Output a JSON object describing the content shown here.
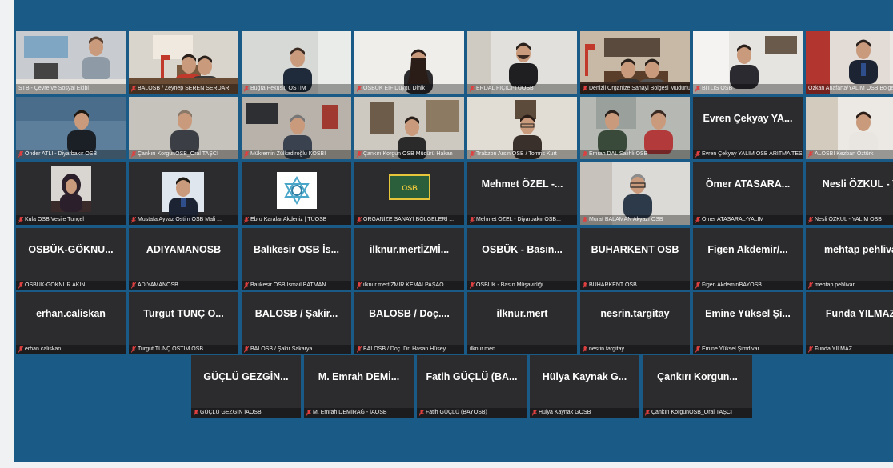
{
  "meeting": {
    "rows": [
      [
        {
          "name": "STB - Çevre ve Sosyal Ekibi",
          "video": "office-map",
          "active": true,
          "muted": false
        },
        {
          "name": "BALOSB / Zeynep SEREN SERDAR",
          "video": "office-flags",
          "muted": true
        },
        {
          "name": "Buğra Pekuslu OSTİM",
          "video": "man-window",
          "muted": true
        },
        {
          "name": "OSBÜK EİF Duygu Dinik",
          "video": "woman-white",
          "muted": true
        },
        {
          "name": "ERDAL FIÇICI-TÜOSB",
          "video": "man-beard",
          "muted": true
        },
        {
          "name": "Denizli Organize Sanayi Bölgesi Müdürlüğü",
          "video": "meeting-room",
          "muted": true
        },
        {
          "name": "BİTLİS OSB",
          "video": "man-office",
          "muted": true
        },
        {
          "name": "Özkan Anafarta/YALIM OSB Bölge Müdürü",
          "video": "man-suit",
          "active": true,
          "muted": false
        }
      ],
      [
        {
          "name": "Önder ATLI - Diyarbakır OSB",
          "video": "man-blue",
          "muted": true
        },
        {
          "name": "Çankırı KorgunOSB_Oral TAŞCI",
          "video": "man-bald",
          "muted": true
        },
        {
          "name": "Mükremin Zülkadiroğlu KOSBİ",
          "video": "man-desk",
          "muted": true
        },
        {
          "name": "Çankırı Korgun OSB Müdürü Hakan",
          "video": "man-laptop",
          "muted": true
        },
        {
          "name": "Trabzon Arsin OSB / Tomris Kurt",
          "video": "woman-glasses",
          "muted": true
        },
        {
          "name": "Emrah DAL Salihli OSB",
          "video": "two-men",
          "muted": true
        },
        {
          "name": "Evren Çekyay YALIM OSB ARITMA TESİSİ MÜ...",
          "display": "Evren Çekyay YA...",
          "muted": true
        },
        {
          "name": "ALOSBİ Kezban Öztürk",
          "video": "woman-smile",
          "muted": true
        }
      ],
      [
        {
          "name": "Kula OSB Vesile Tunçel",
          "video": "woman-hijab",
          "muted": true
        },
        {
          "name": "Mustafa Ayvaz Ostim OSB Mali ...",
          "video": "portrait",
          "muted": true
        },
        {
          "name": "Ebru Karalar Akdeniz | TÜOSB",
          "video": "logo-star",
          "muted": true
        },
        {
          "name": "ORGANİZE SANAYİ BÖLGELERİ ...",
          "video": "logo-osb",
          "muted": true
        },
        {
          "name": "Mehmet ÖZEL - Diyarbakır OSB...",
          "display": "Mehmet ÖZEL -...",
          "muted": true
        },
        {
          "name": "Murat BALAMAN Akyazı OSB",
          "video": "man-glasses",
          "muted": true
        },
        {
          "name": "Ömer ATASARAL-YALIM",
          "display": "Ömer ATASARA...",
          "muted": true
        },
        {
          "name": "Nesli ÖZKUL - YALIM OSB",
          "display": "Nesli ÖZKUL - Y",
          "muted": true
        }
      ],
      [
        {
          "name": "OSBÜK-GÖKNUR AKIN",
          "display": "OSBÜK-GÖKNU...",
          "muted": true
        },
        {
          "name": "ADIYAMANOSB",
          "display": "ADIYAMANOSB",
          "muted": true
        },
        {
          "name": "Balıkesir OSB İsmail BATMAN",
          "display": "Balıkesir OSB İs...",
          "muted": true
        },
        {
          "name": "ilknur.mertİZMİR KEMALPAŞAO...",
          "display": "ilknur.mertİZMİ...",
          "muted": true
        },
        {
          "name": "OSBÜK - Basın Müşavirliği",
          "display": "OSBÜK - Basın...",
          "muted": true
        },
        {
          "name": "BUHARKENT OSB",
          "display": "BUHARKENT OSB",
          "muted": true
        },
        {
          "name": "Figen Akdemir/BAYOSB",
          "display": "Figen Akdemir/...",
          "muted": true
        },
        {
          "name": "mehtap pehlivan",
          "display": "mehtap pehliva",
          "muted": true
        }
      ],
      [
        {
          "name": "erhan.caliskan",
          "display": "erhan.caliskan",
          "muted": true
        },
        {
          "name": "Turgut TUNÇ OSTİM OSB",
          "display": "Turgut TUNÇ O...",
          "muted": true
        },
        {
          "name": "BALOSB / Şakir Sakarya",
          "display": "BALOSB / Şakir...",
          "muted": true
        },
        {
          "name": "BALOSB / Doç. Dr. Hasan Hüsey...",
          "display": "BALOSB / Doç....",
          "muted": true
        },
        {
          "name": "ilknur.mert",
          "display": "ilknur.mert",
          "muted": false
        },
        {
          "name": "nesrin.targitay",
          "display": "nesrin.targitay",
          "muted": true
        },
        {
          "name": "Emine Yüksel Şimdivar",
          "display": "Emine Yüksel Şi...",
          "muted": true
        },
        {
          "name": "Funda YILMAZ",
          "display": "Funda YILMAZ",
          "muted": true
        }
      ],
      [
        {
          "name": "GÜÇLÜ GEZGİN İAOSB",
          "display": "GÜÇLÜ GEZGİN...",
          "muted": true
        },
        {
          "name": "M. Emrah DEMİRAĞ - İAOSB",
          "display": "M. Emrah DEMİ...",
          "muted": true
        },
        {
          "name": "Fatih GÜÇLÜ (BAYOSB)",
          "display": "Fatih GÜÇLÜ (BA...",
          "muted": true
        },
        {
          "name": "Hülya Kaynak GOSB",
          "display": "Hülya Kaynak G...",
          "muted": true
        },
        {
          "name": "Çankırı KorgunOSB_Oral TAŞCI",
          "display": "Çankırı Korgun...",
          "muted": true
        }
      ]
    ]
  }
}
